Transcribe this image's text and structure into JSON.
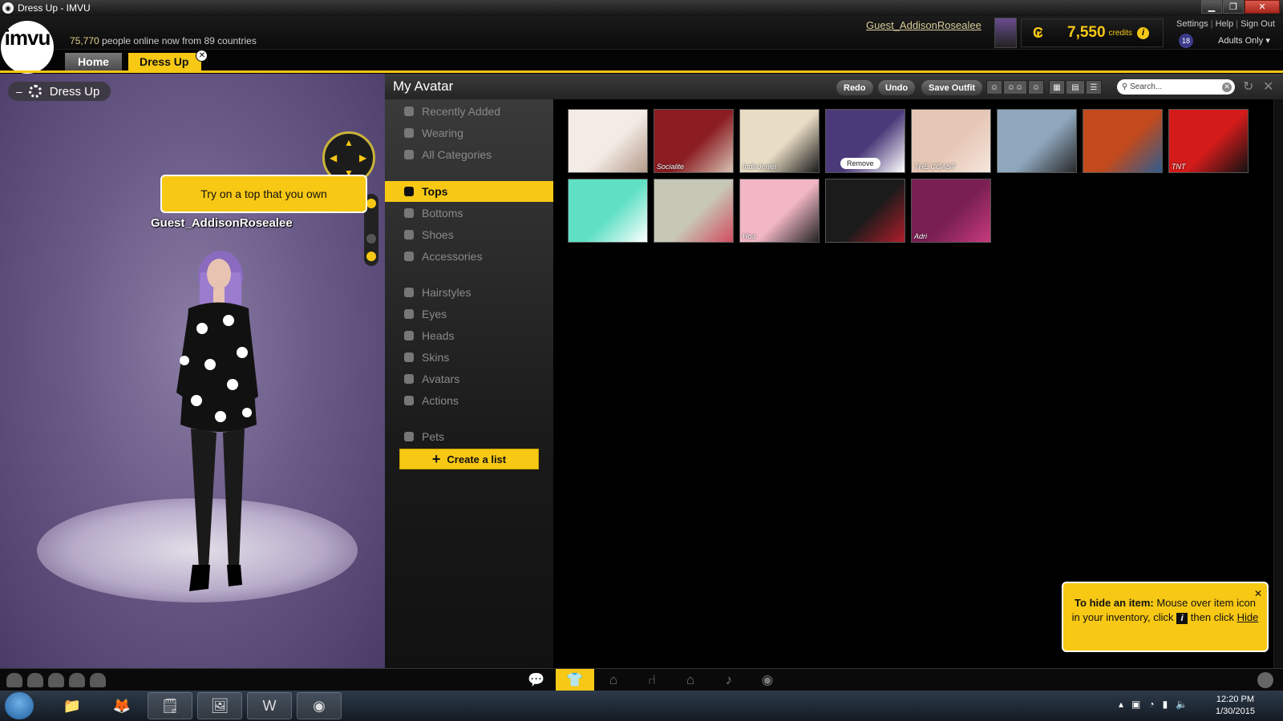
{
  "window": {
    "title": "Dress Up - IMVU",
    "app_icon": "imvu-icon"
  },
  "header": {
    "logo_text": "imvu",
    "online_count": "75,770",
    "online_suffix": "people online now from 89 countries",
    "tabs": [
      {
        "label": "Home"
      },
      {
        "label": "Dress Up"
      }
    ],
    "username": "Guest_AddisonRosealee",
    "credits_amount": "7,550",
    "credits_label": "credits",
    "links": {
      "settings": "Settings",
      "help": "Help",
      "sign_out": "Sign Out"
    },
    "adult_badge": "18",
    "adults_only": "Adults Only"
  },
  "viewport": {
    "title": "Dress Up",
    "tooltip": "Try on a top that you own",
    "avatar_name": "Guest_AddisonRosealee"
  },
  "panel": {
    "title": "My Avatar",
    "buttons": {
      "redo": "Redo",
      "undo": "Undo",
      "save_outfit": "Save Outfit"
    },
    "search_placeholder": "Search..."
  },
  "categories": {
    "group1": [
      "Recently Added",
      "Wearing",
      "All Categories"
    ],
    "group2": [
      "Tops",
      "Bottoms",
      "Shoes",
      "Accessories"
    ],
    "group3": [
      "Hairstyles",
      "Eyes",
      "Heads",
      "Skins",
      "Avatars",
      "Actions"
    ],
    "group4": [
      "Pets"
    ],
    "active": "Tops",
    "create_list": "Create a list"
  },
  "items": [
    {
      "label": "",
      "colors": [
        "#f3ece6",
        "#b49a8a"
      ]
    },
    {
      "label": "Socialite",
      "colors": [
        "#8b1c22",
        "#d7c3b3"
      ]
    },
    {
      "label": "IndivJewel",
      "colors": [
        "#e8dcc4",
        "#1a1a1a"
      ]
    },
    {
      "label": "",
      "colors": [
        "#4b3a7a",
        "#ffffff"
      ],
      "remove": "Remove"
    },
    {
      "label": "THE COAST",
      "colors": [
        "#e6c7b6",
        "#f4e6dc"
      ]
    },
    {
      "label": "",
      "colors": [
        "#8ea7bd",
        "#2a2a2a"
      ]
    },
    {
      "label": "",
      "colors": [
        "#c24a1c",
        "#2f5d8f"
      ]
    },
    {
      "label": "TNT",
      "colors": [
        "#d41b1b",
        "#111111"
      ]
    },
    {
      "label": "",
      "colors": [
        "#5fe0c4",
        "#ffffff"
      ]
    },
    {
      "label": "",
      "colors": [
        "#c7c7b6",
        "#d24c5f"
      ]
    },
    {
      "label": "Hoa",
      "colors": [
        "#f2b7c5",
        "#222222"
      ]
    },
    {
      "label": "",
      "colors": [
        "#1b1b1b",
        "#b01e2a"
      ]
    },
    {
      "label": "Adri",
      "colors": [
        "#7a1f52",
        "#c93b7e"
      ]
    }
  ],
  "hide_tip": {
    "bold": "To hide an item:",
    "text1": " Mouse over item icon in your inventory, click ",
    "text2": " then click ",
    "link": "Hide"
  },
  "taskbar": {
    "time": "12:20 PM",
    "date": "1/30/2015"
  },
  "colors": {
    "accent": "#f7c814"
  }
}
